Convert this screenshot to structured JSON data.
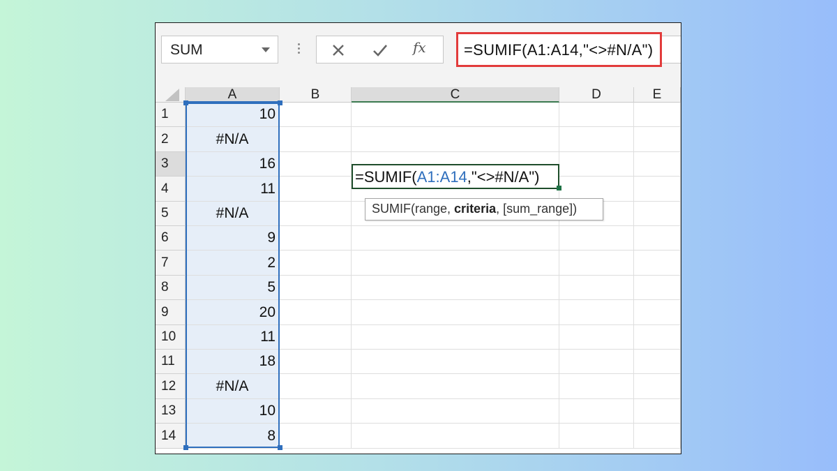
{
  "name_box": {
    "value": "SUM"
  },
  "formula_bar": {
    "cancel_icon": "close-icon",
    "enter_icon": "check-icon",
    "fx_label": "fx",
    "value": "=SUMIF(A1:A14,\"<>#N/A\")",
    "highlight_color": "#e23b3b"
  },
  "columns": [
    "A",
    "B",
    "C",
    "D",
    "E"
  ],
  "rows": [
    {
      "n": "1",
      "a": "10"
    },
    {
      "n": "2",
      "a": "#N/A"
    },
    {
      "n": "3",
      "a": "16"
    },
    {
      "n": "4",
      "a": "11"
    },
    {
      "n": "5",
      "a": "#N/A"
    },
    {
      "n": "6",
      "a": "9"
    },
    {
      "n": "7",
      "a": "2"
    },
    {
      "n": "8",
      "a": "5"
    },
    {
      "n": "9",
      "a": "20"
    },
    {
      "n": "10",
      "a": "11"
    },
    {
      "n": "11",
      "a": "18"
    },
    {
      "n": "12",
      "a": "#N/A"
    },
    {
      "n": "13",
      "a": "10"
    },
    {
      "n": "14",
      "a": "8"
    }
  ],
  "active_cell": {
    "ref": "C3",
    "prefix": "=SUMIF(",
    "range": "A1:A14",
    "suffix": ",\"<>#N/A\")"
  },
  "tooltip": {
    "fn": "SUMIF(",
    "arg1": "range, ",
    "arg2": "criteria",
    "arg3": ", [sum_range])"
  },
  "colors": {
    "selection": "#2f6fbd",
    "active_border": "#1e4d2b",
    "selected_fill": "#e6eef8"
  }
}
